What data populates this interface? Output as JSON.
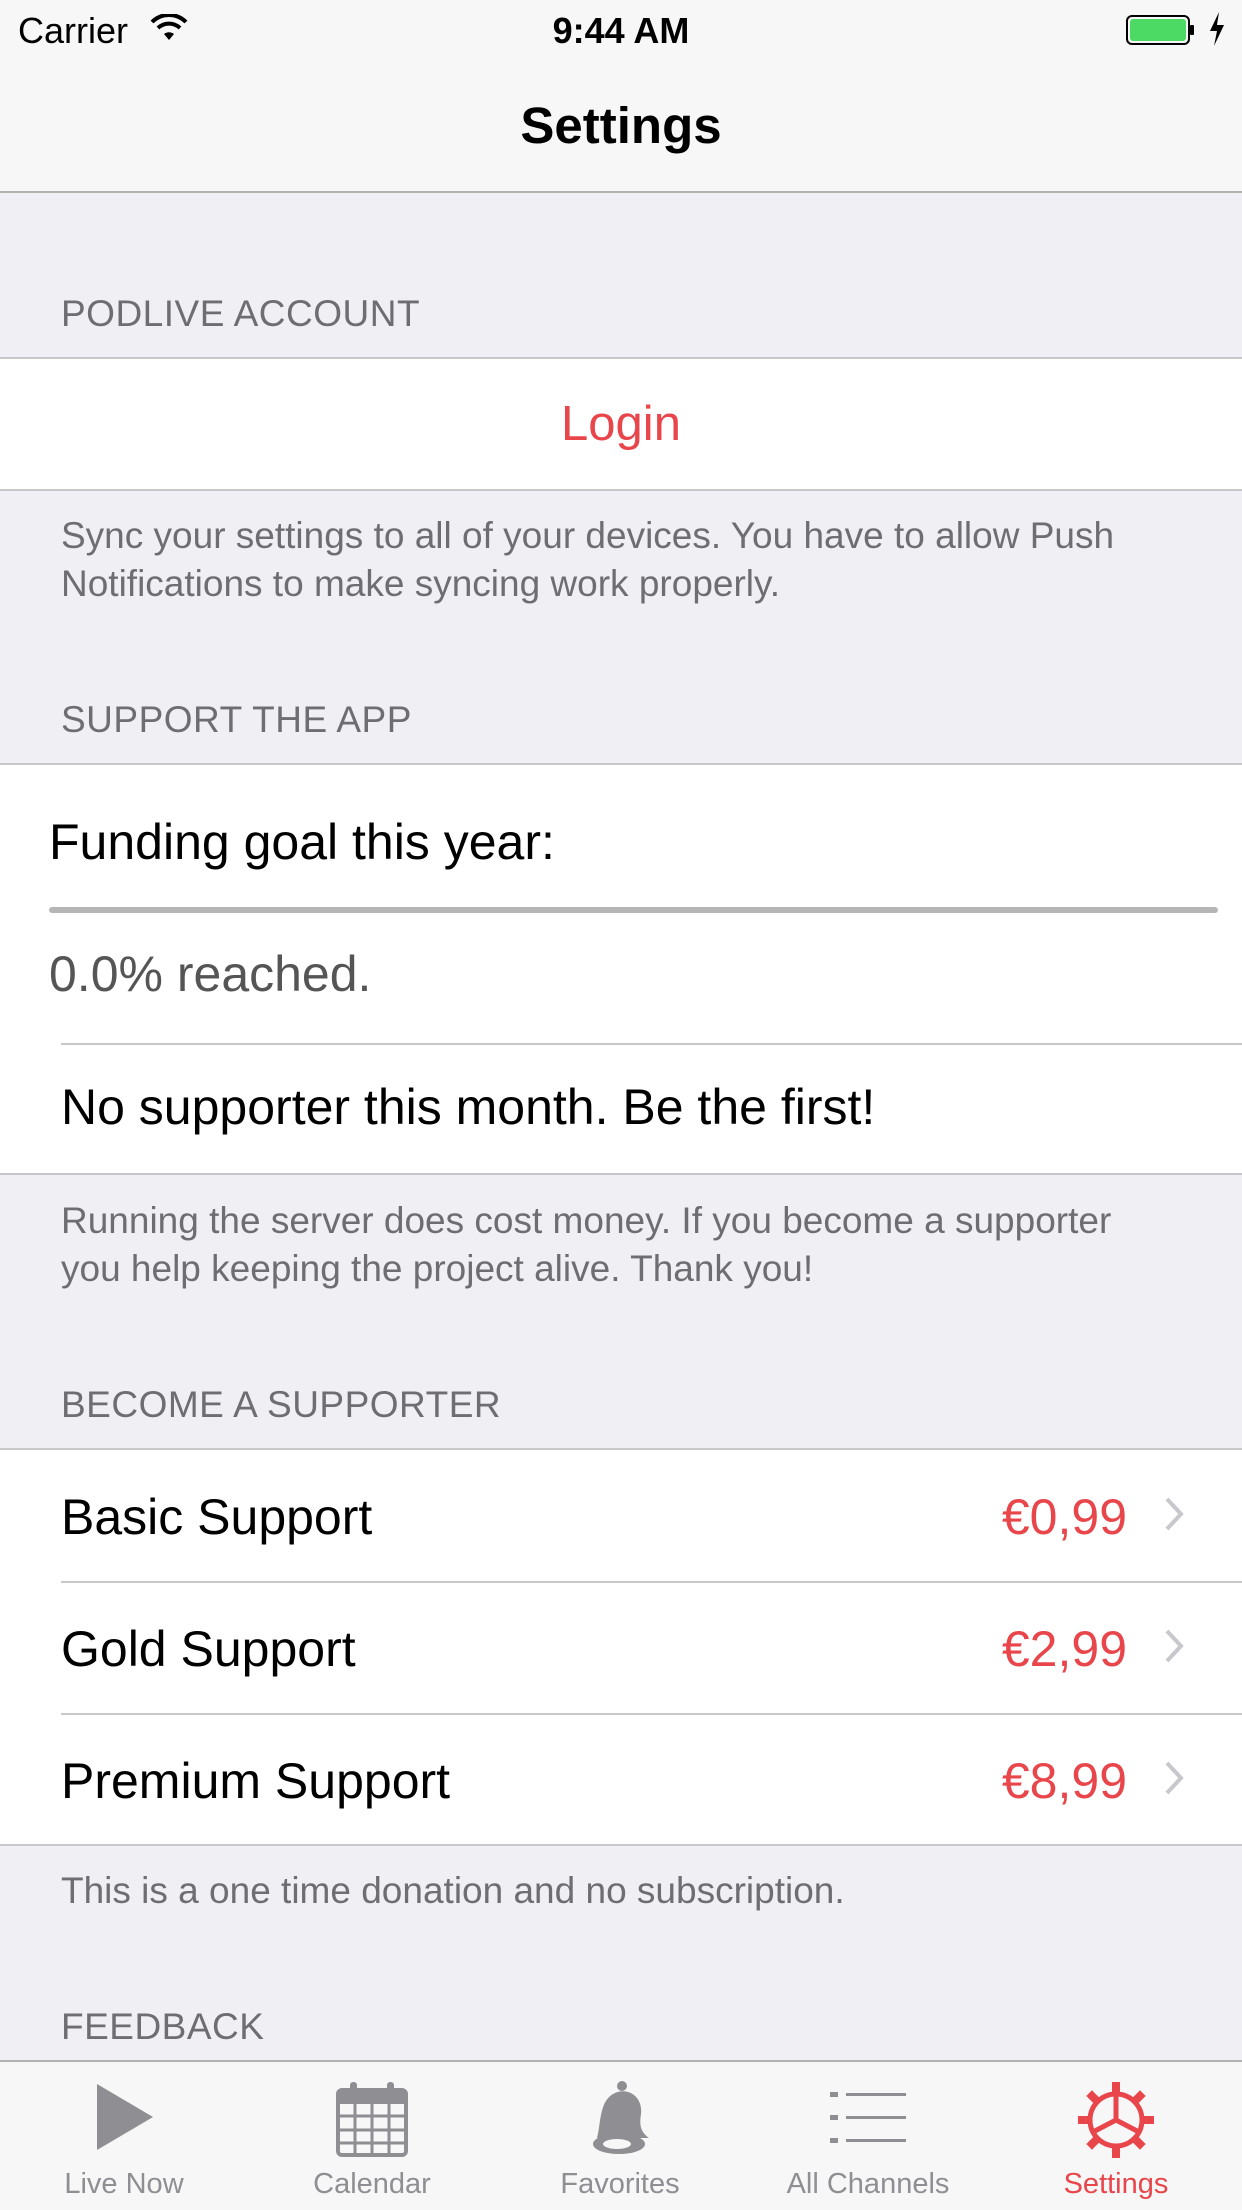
{
  "status_bar": {
    "carrier": "Carrier",
    "time": "9:44 AM",
    "icons": [
      "wifi-icon",
      "battery-icon",
      "charging-bolt-icon"
    ]
  },
  "nav": {
    "title": "Settings"
  },
  "account": {
    "header": "PODLIVE ACCOUNT",
    "login_label": "Login",
    "footer": "Sync your settings to all of your devices. You have to allow Push Notifications to make syncing work properly."
  },
  "support": {
    "header": "SUPPORT THE APP",
    "funding_label": "Funding goal this year:",
    "progress_fraction": 0.0,
    "progress_text": "0.0% reached.",
    "supporter_text": "No supporter this month. Be the first!",
    "footer": "Running the server does cost money. If you become a supporter you help keeping the project alive. Thank you!"
  },
  "supporter": {
    "header": "BECOME A SUPPORTER",
    "tiers": [
      {
        "name": "Basic Support",
        "price": "€0,99"
      },
      {
        "name": "Gold Support",
        "price": "€2,99"
      },
      {
        "name": "Premium Support",
        "price": "€8,99"
      }
    ],
    "footer": "This is a one time donation and no subscription."
  },
  "feedback": {
    "header": "FEEDBACK"
  },
  "tabs": [
    {
      "label": "Live Now",
      "icon": "play-icon",
      "active": false
    },
    {
      "label": "Calendar",
      "icon": "calendar-icon",
      "active": false
    },
    {
      "label": "Favorites",
      "icon": "bell-icon",
      "active": false
    },
    {
      "label": "All Channels",
      "icon": "list-icon",
      "active": false
    },
    {
      "label": "Settings",
      "icon": "gear-icon",
      "active": true
    }
  ],
  "colors": {
    "accent": "#e8464b",
    "inactive_tab": "#8e8e93",
    "background": "#efeff4",
    "battery_fill": "#4cd964"
  }
}
